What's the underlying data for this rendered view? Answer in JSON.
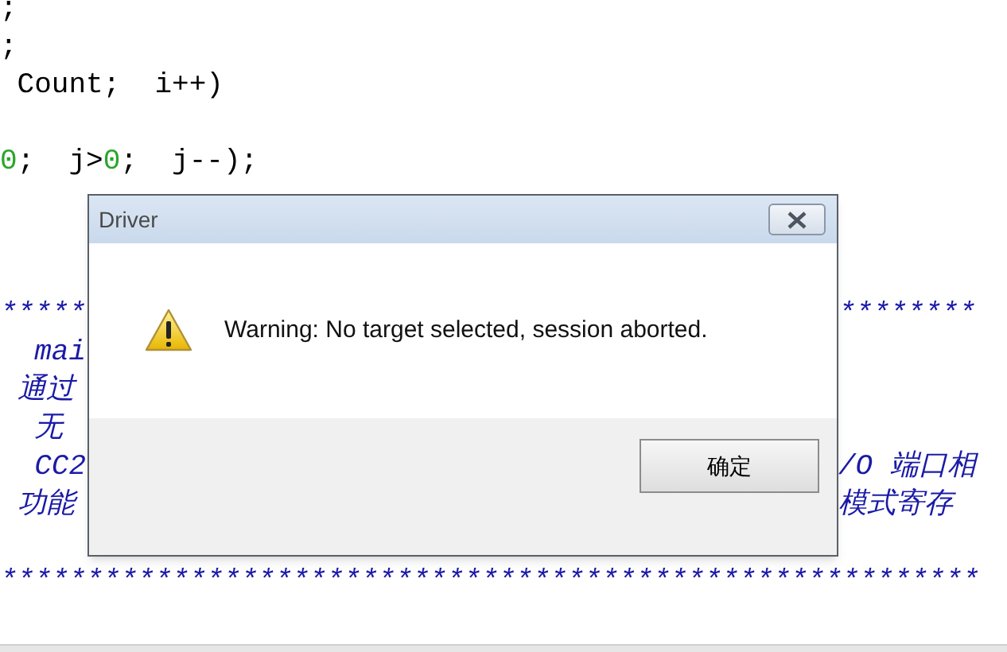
{
  "editor": {
    "lines": [
      {
        "kind": "code",
        "left": [
          {
            "text": ";",
            "kind": "code"
          }
        ]
      },
      {
        "kind": "code",
        "left": [
          {
            "text": ";",
            "kind": "code"
          }
        ]
      },
      {
        "kind": "code",
        "left": [
          {
            "text": " Count;  i++)",
            "kind": "code"
          }
        ]
      },
      {
        "kind": "blank"
      },
      {
        "kind": "code",
        "left": [
          {
            "text": "0",
            "kind": "number"
          },
          {
            "text": ";  j>",
            "kind": "code"
          },
          {
            "text": "0",
            "kind": "number"
          },
          {
            "text": ";  j--);",
            "kind": "code"
          }
        ]
      },
      {
        "kind": "blank"
      },
      {
        "kind": "blank"
      },
      {
        "kind": "blank"
      },
      {
        "kind": "code",
        "left": [
          {
            "text": "*****",
            "kind": "comment"
          }
        ],
        "right": [
          {
            "text": "********",
            "kind": "comment"
          }
        ]
      },
      {
        "kind": "code",
        "left": [
          {
            "text": "  mai",
            "kind": "comment"
          }
        ]
      },
      {
        "kind": "code",
        "left": [
          {
            "text": " 通过",
            "kind": "comment"
          }
        ]
      },
      {
        "kind": "code",
        "left": [
          {
            "text": "  无",
            "kind": "comment"
          }
        ]
      },
      {
        "kind": "code",
        "left": [
          {
            "text": "  CC2",
            "kind": "comment"
          }
        ],
        "right": [
          {
            "text": "/O 端口相",
            "kind": "comment"
          }
        ]
      },
      {
        "kind": "code",
        "left": [
          {
            "text": " 功能",
            "kind": "comment"
          }
        ],
        "right": [
          {
            "text": "模式寄存",
            "kind": "comment"
          }
        ]
      },
      {
        "kind": "blank"
      },
      {
        "kind": "code",
        "left": [
          {
            "text": "*********************************************************",
            "kind": "comment"
          }
        ]
      }
    ]
  },
  "dialog": {
    "title": "Driver",
    "message": "Warning: No target selected, session aborted.",
    "buttons": [
      "确定"
    ]
  }
}
